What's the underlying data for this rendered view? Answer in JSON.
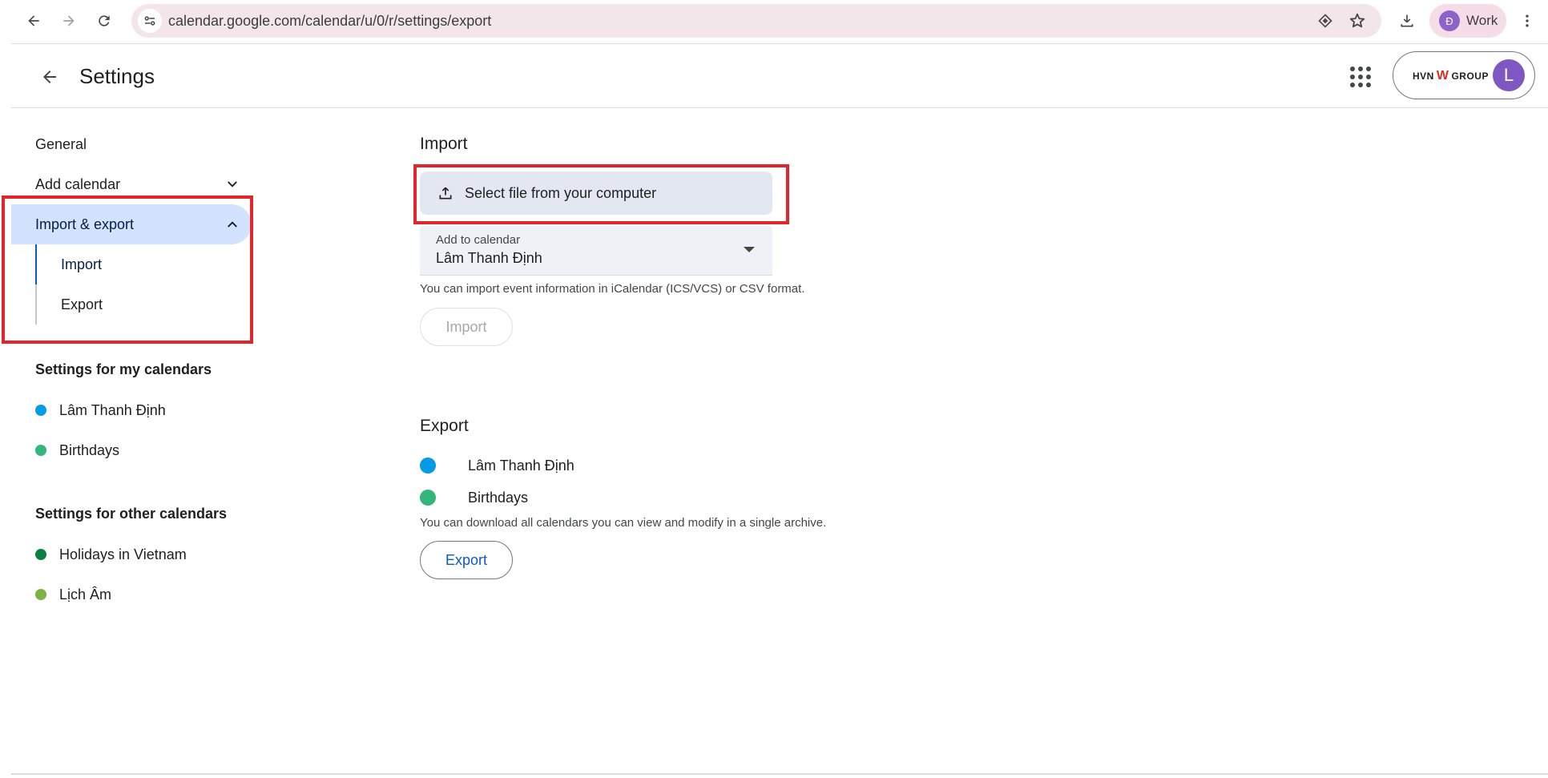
{
  "browser": {
    "url": "calendar.google.com/calendar/u/0/r/settings/export",
    "profile_initial": "Đ",
    "profile_label": "Work",
    "icons": [
      "back-icon",
      "forward-icon",
      "reload-icon",
      "site-info-icon",
      "lens-icon",
      "star-icon",
      "download-icon",
      "more-vert-icon"
    ]
  },
  "header": {
    "title": "Settings",
    "logo_left": "HVN",
    "logo_right": "GROUP",
    "account_initial": "L"
  },
  "sidebar": {
    "general": "General",
    "add_calendar": "Add calendar",
    "import_export": "Import & export",
    "import_sub": "Import",
    "export_sub": "Export",
    "my_calendars_heading": "Settings for my calendars",
    "my_calendars": [
      {
        "name": "Lâm Thanh Định",
        "color": "#039be5"
      },
      {
        "name": "Birthdays",
        "color": "#33b679"
      }
    ],
    "other_calendars_heading": "Settings for other calendars",
    "other_calendars": [
      {
        "name": "Holidays in Vietnam",
        "color": "#0b8043"
      },
      {
        "name": "Lịch Âm",
        "color": "#7cb342"
      }
    ]
  },
  "import": {
    "title": "Import",
    "select_file": "Select file from your computer",
    "add_to_label": "Add to calendar",
    "add_to_value": "Lâm Thanh Định",
    "help": "You can import event information in iCalendar (ICS/VCS) or CSV format.",
    "button": "Import"
  },
  "export": {
    "title": "Export",
    "calendars": [
      {
        "name": "Lâm Thanh Định",
        "color": "#039be5"
      },
      {
        "name": "Birthdays",
        "color": "#33b679"
      }
    ],
    "help": "You can download all calendars you can view and modify in a single archive.",
    "button": "Export"
  },
  "colors": {
    "active_nav": "#d3e3fd",
    "highlight": "#e3242b",
    "accent": "#0b57d0"
  }
}
